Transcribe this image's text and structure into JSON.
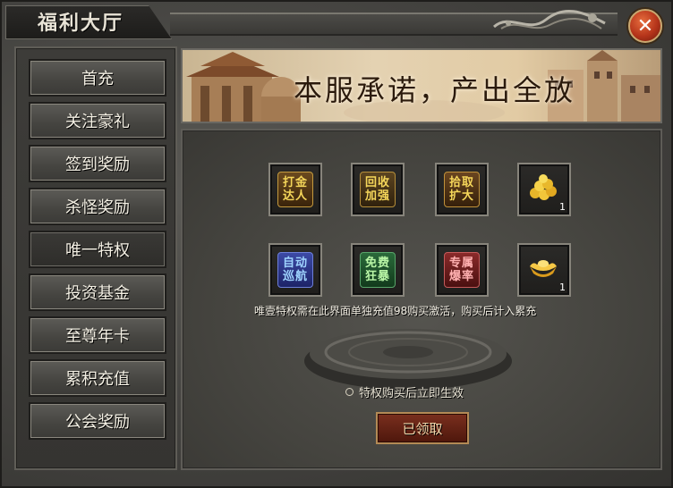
{
  "window": {
    "title": "福利大厅",
    "close_symbol": "✕"
  },
  "sidebar": {
    "items": [
      {
        "label": "首充"
      },
      {
        "label": "关注豪礼"
      },
      {
        "label": "签到奖励"
      },
      {
        "label": "杀怪奖励"
      },
      {
        "label": "唯一特权",
        "selected": true
      },
      {
        "label": "投资基金"
      },
      {
        "label": "至尊年卡"
      },
      {
        "label": "累积充值"
      },
      {
        "label": "公会奖励"
      }
    ]
  },
  "banner": {
    "text": "本服承诺，产出全放"
  },
  "privileges": {
    "row1": [
      {
        "line1": "打金",
        "line2": "达人"
      },
      {
        "line1": "回收",
        "line2": "加强"
      },
      {
        "line1": "拾取",
        "line2": "扩大"
      },
      {
        "icon": "gold-coins-icon",
        "count": "1"
      }
    ],
    "row2": [
      {
        "line1": "自动",
        "line2": "巡航"
      },
      {
        "line1": "免费",
        "line2": "狂暴"
      },
      {
        "line1": "专属",
        "line2": "爆率"
      },
      {
        "icon": "gold-ingot-icon",
        "count": "1"
      }
    ]
  },
  "notice": "唯壹特权需在此界面单独充值98购买激活，购买后计入累充",
  "tip": "特权购买后立即生效",
  "claim_button": "已领取",
  "colors": {
    "gold_text": "#f1d04a",
    "accent_red": "#b5341a"
  }
}
